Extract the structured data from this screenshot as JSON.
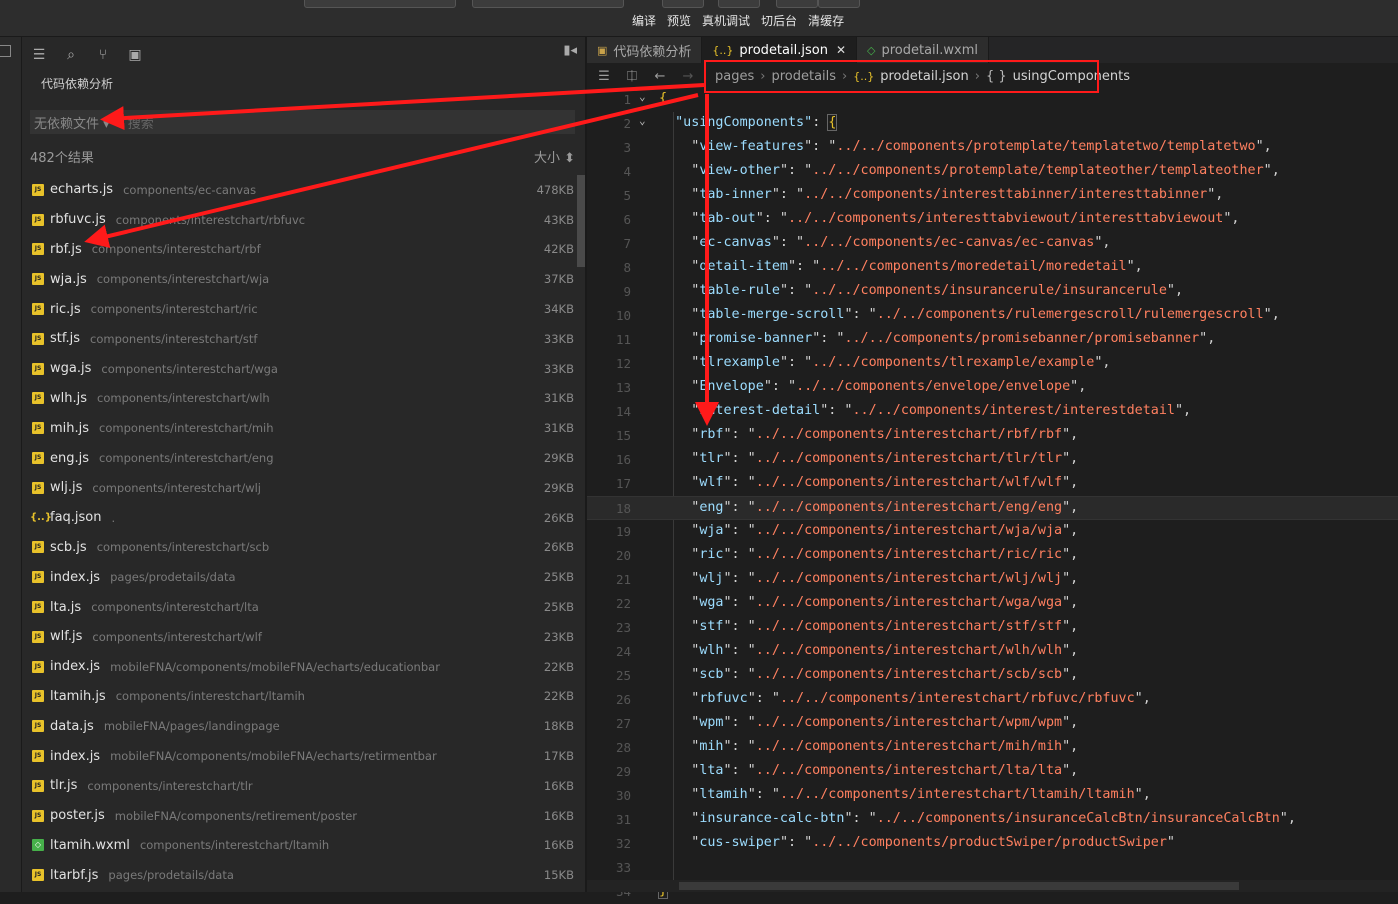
{
  "toolbar": {
    "labels": [
      "编译",
      "预览",
      "真机调试",
      "切后台",
      "清缓存"
    ]
  },
  "sidebar": {
    "title": "代码依赖分析",
    "filter_value": "无依赖文件",
    "search_placeholder": "搜索",
    "result_count": "482个结果",
    "sort_label": "大小",
    "files": [
      {
        "name": "echarts.js",
        "path": "components/ec-canvas",
        "size": "478KB",
        "type": "js"
      },
      {
        "name": "rbfuvc.js",
        "path": "components/interestchart/rbfuvc",
        "size": "43KB",
        "type": "js"
      },
      {
        "name": "rbf.js",
        "path": "components/interestchart/rbf",
        "size": "42KB",
        "type": "js"
      },
      {
        "name": "wja.js",
        "path": "components/interestchart/wja",
        "size": "37KB",
        "type": "js"
      },
      {
        "name": "ric.js",
        "path": "components/interestchart/ric",
        "size": "34KB",
        "type": "js"
      },
      {
        "name": "stf.js",
        "path": "components/interestchart/stf",
        "size": "33KB",
        "type": "js"
      },
      {
        "name": "wga.js",
        "path": "components/interestchart/wga",
        "size": "33KB",
        "type": "js"
      },
      {
        "name": "wlh.js",
        "path": "components/interestchart/wlh",
        "size": "31KB",
        "type": "js"
      },
      {
        "name": "mih.js",
        "path": "components/interestchart/mih",
        "size": "31KB",
        "type": "js"
      },
      {
        "name": "eng.js",
        "path": "components/interestchart/eng",
        "size": "29KB",
        "type": "js"
      },
      {
        "name": "wlj.js",
        "path": "components/interestchart/wlj",
        "size": "29KB",
        "type": "js"
      },
      {
        "name": "faq.json",
        "path": ".",
        "size": "26KB",
        "type": "json"
      },
      {
        "name": "scb.js",
        "path": "components/interestchart/scb",
        "size": "26KB",
        "type": "js"
      },
      {
        "name": "index.js",
        "path": "pages/prodetails/data",
        "size": "25KB",
        "type": "js"
      },
      {
        "name": "lta.js",
        "path": "components/interestchart/lta",
        "size": "25KB",
        "type": "js"
      },
      {
        "name": "wlf.js",
        "path": "components/interestchart/wlf",
        "size": "23KB",
        "type": "js"
      },
      {
        "name": "index.js",
        "path": "mobileFNA/components/mobileFNA/echarts/educationbar",
        "size": "22KB",
        "type": "js"
      },
      {
        "name": "ltamih.js",
        "path": "components/interestchart/ltamih",
        "size": "22KB",
        "type": "js"
      },
      {
        "name": "data.js",
        "path": "mobileFNA/pages/landingpage",
        "size": "18KB",
        "type": "js"
      },
      {
        "name": "index.js",
        "path": "mobileFNA/components/mobileFNA/echarts/retirmentbar",
        "size": "17KB",
        "type": "js"
      },
      {
        "name": "tlr.js",
        "path": "components/interestchart/tlr",
        "size": "16KB",
        "type": "js"
      },
      {
        "name": "poster.js",
        "path": "mobileFNA/components/retirement/poster",
        "size": "16KB",
        "type": "js"
      },
      {
        "name": "ltamih.wxml",
        "path": "components/interestchart/ltamih",
        "size": "16KB",
        "type": "wxml"
      },
      {
        "name": "ltarbf.js",
        "path": "pages/prodetails/data",
        "size": "15KB",
        "type": "js"
      }
    ]
  },
  "editor": {
    "tabs": [
      {
        "label": "代码依赖分析",
        "icon": "dependency-icon",
        "active": false
      },
      {
        "label": "prodetail.json",
        "icon": "json-icon",
        "active": true
      },
      {
        "label": "prodetail.wxml",
        "icon": "wxml-icon",
        "active": false
      }
    ],
    "breadcrumb": [
      "pages",
      "prodetails",
      "prodetail.json",
      "usingComponents"
    ],
    "highlighted_line": 18,
    "components": [
      {
        "key": "view-features",
        "value": "../../components/protemplate/templatetwo/templatetwo"
      },
      {
        "key": "view-other",
        "value": "../../components/protemplate/templateother/templateother"
      },
      {
        "key": "tab-inner",
        "value": "../../components/interesttabinner/interesttabinner"
      },
      {
        "key": "tab-out",
        "value": "../../components/interesttabviewout/interesttabviewout"
      },
      {
        "key": "ec-canvas",
        "value": "../../components/ec-canvas/ec-canvas"
      },
      {
        "key": "detail-item",
        "value": "../../components/moredetail/moredetail"
      },
      {
        "key": "table-rule",
        "value": "../../components/insurancerule/insurancerule"
      },
      {
        "key": "table-merge-scroll",
        "value": "../../components/rulemergescroll/rulemergescroll"
      },
      {
        "key": "promise-banner",
        "value": "../../components/promisebanner/promisebanner"
      },
      {
        "key": "tlrexample",
        "value": "../../components/tlrexample/example"
      },
      {
        "key": "Envelope",
        "value": "../../components/envelope/envelope"
      },
      {
        "key": "interest-detail",
        "value": "../../components/interest/interestdetail"
      },
      {
        "key": "rbf",
        "value": "../../components/interestchart/rbf/rbf"
      },
      {
        "key": "tlr",
        "value": "../../components/interestchart/tlr/tlr"
      },
      {
        "key": "wlf",
        "value": "../../components/interestchart/wlf/wlf"
      },
      {
        "key": "eng",
        "value": "../../components/interestchart/eng/eng"
      },
      {
        "key": "wja",
        "value": "../../components/interestchart/wja/wja"
      },
      {
        "key": "ric",
        "value": "../../components/interestchart/ric/ric"
      },
      {
        "key": "wlj",
        "value": "../../components/interestchart/wlj/wlj"
      },
      {
        "key": "wga",
        "value": "../../components/interestchart/wga/wga"
      },
      {
        "key": "stf",
        "value": "../../components/interestchart/stf/stf"
      },
      {
        "key": "wlh",
        "value": "../../components/interestchart/wlh/wlh"
      },
      {
        "key": "scb",
        "value": "../../components/interestchart/scb/scb"
      },
      {
        "key": "rbfuvc",
        "value": "../../components/interestchart/rbfuvc/rbfuvc"
      },
      {
        "key": "wpm",
        "value": "../../components/interestchart/wpm/wpm"
      },
      {
        "key": "mih",
        "value": "../../components/interestchart/mih/mih"
      },
      {
        "key": "lta",
        "value": "../../components/interestchart/lta/lta"
      },
      {
        "key": "ltamih",
        "value": "../../components/interestchart/ltamih/ltamih"
      },
      {
        "key": "insurance-calc-btn",
        "value": "../../components/insuranceCalcBtn/insuranceCalcBtn"
      },
      {
        "key": "cus-swiper",
        "value": "../../components/productSwiper/productSwiper"
      }
    ]
  },
  "colors": {
    "annotation": "#ff1a1a",
    "json_key": "#9cdcfe",
    "json_string": "#ff8060"
  }
}
